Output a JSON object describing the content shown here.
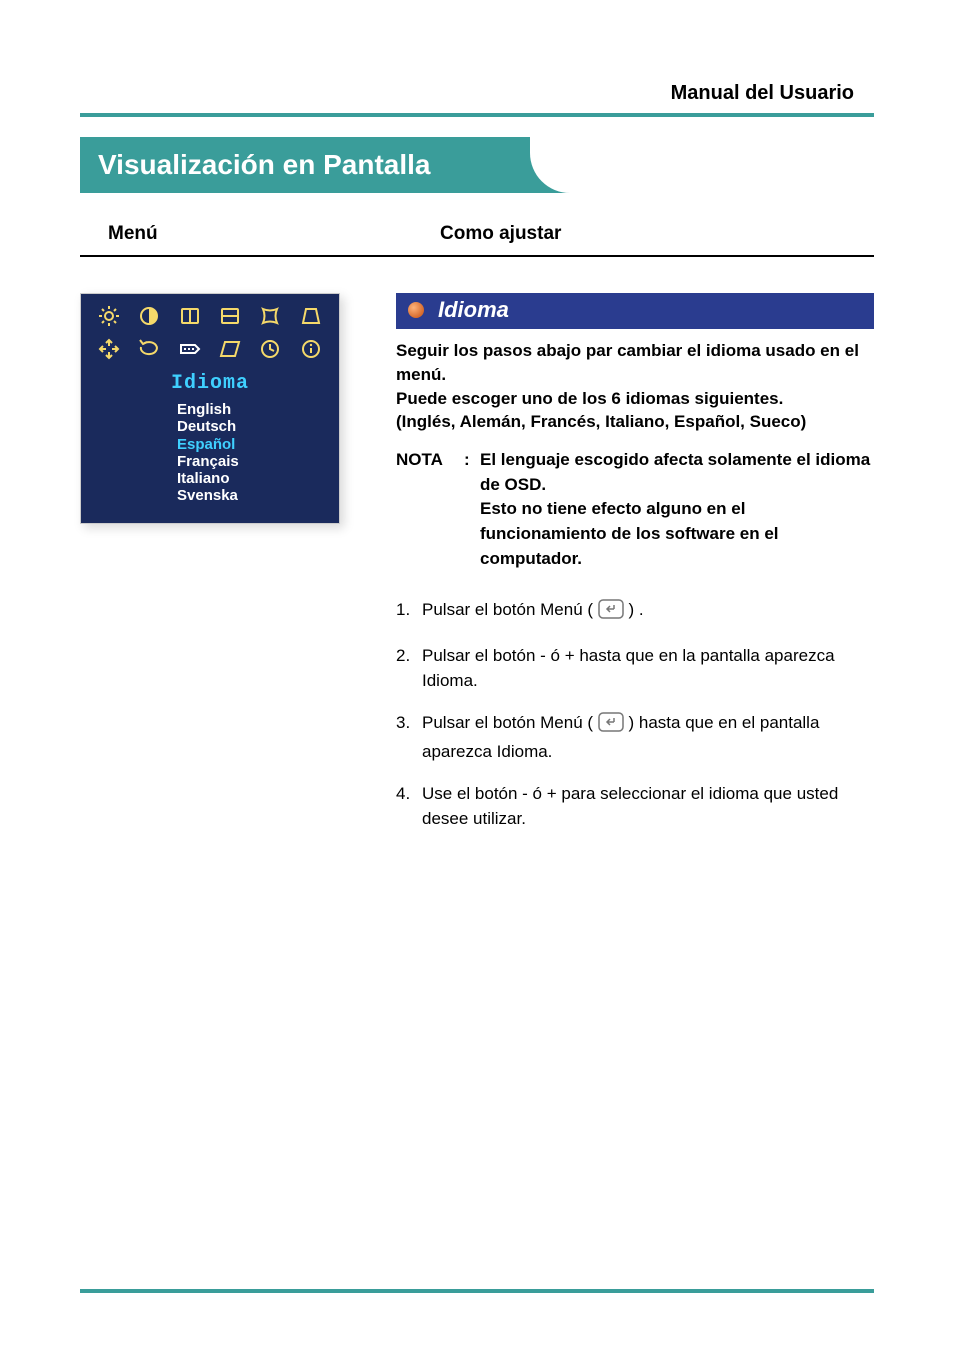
{
  "header": {
    "manual_title": "Manual del Usuario"
  },
  "page_title": "Visualización en Pantalla",
  "columns": {
    "menu": "Menú",
    "adjust": "Como ajustar"
  },
  "osd": {
    "title": "Idioma",
    "langs": [
      "English",
      "Deutsch",
      "Español",
      "Français",
      "Italiano",
      "Svenska"
    ],
    "selected_index": 2
  },
  "section": {
    "title": "Idioma",
    "intro_1": "Seguir los pasos abajo par cambiar el idioma usado en el menú.",
    "intro_2": "Puede escoger uno de los 6 idiomas siguientes.",
    "intro_3": "(Inglés, Alemán, Francés, Italiano, Español, Sueco)",
    "note_label": "NOTA",
    "note_colon": ":",
    "note_body_1": "El lenguaje escogido afecta solamente el idioma de OSD.",
    "note_body_2": "Esto no tiene efecto alguno en el funcionamiento de los software en el computador."
  },
  "steps": {
    "s1_num": "1.",
    "s1_a": "Pulsar el botón Menú ( ",
    "s1_b": " ) .",
    "s2_num": "2.",
    "s2": "Pulsar el botón - ó + hasta que en la pantalla aparezca Idioma.",
    "s3_num": "3.",
    "s3_a": "Pulsar el botón Menú  ( ",
    "s3_b": " ) hasta que en el pantalla aparezca Idioma.",
    "s4_num": "4.",
    "s4": "Use el botón - ó + para seleccionar el idioma que usted desee utilizar."
  }
}
